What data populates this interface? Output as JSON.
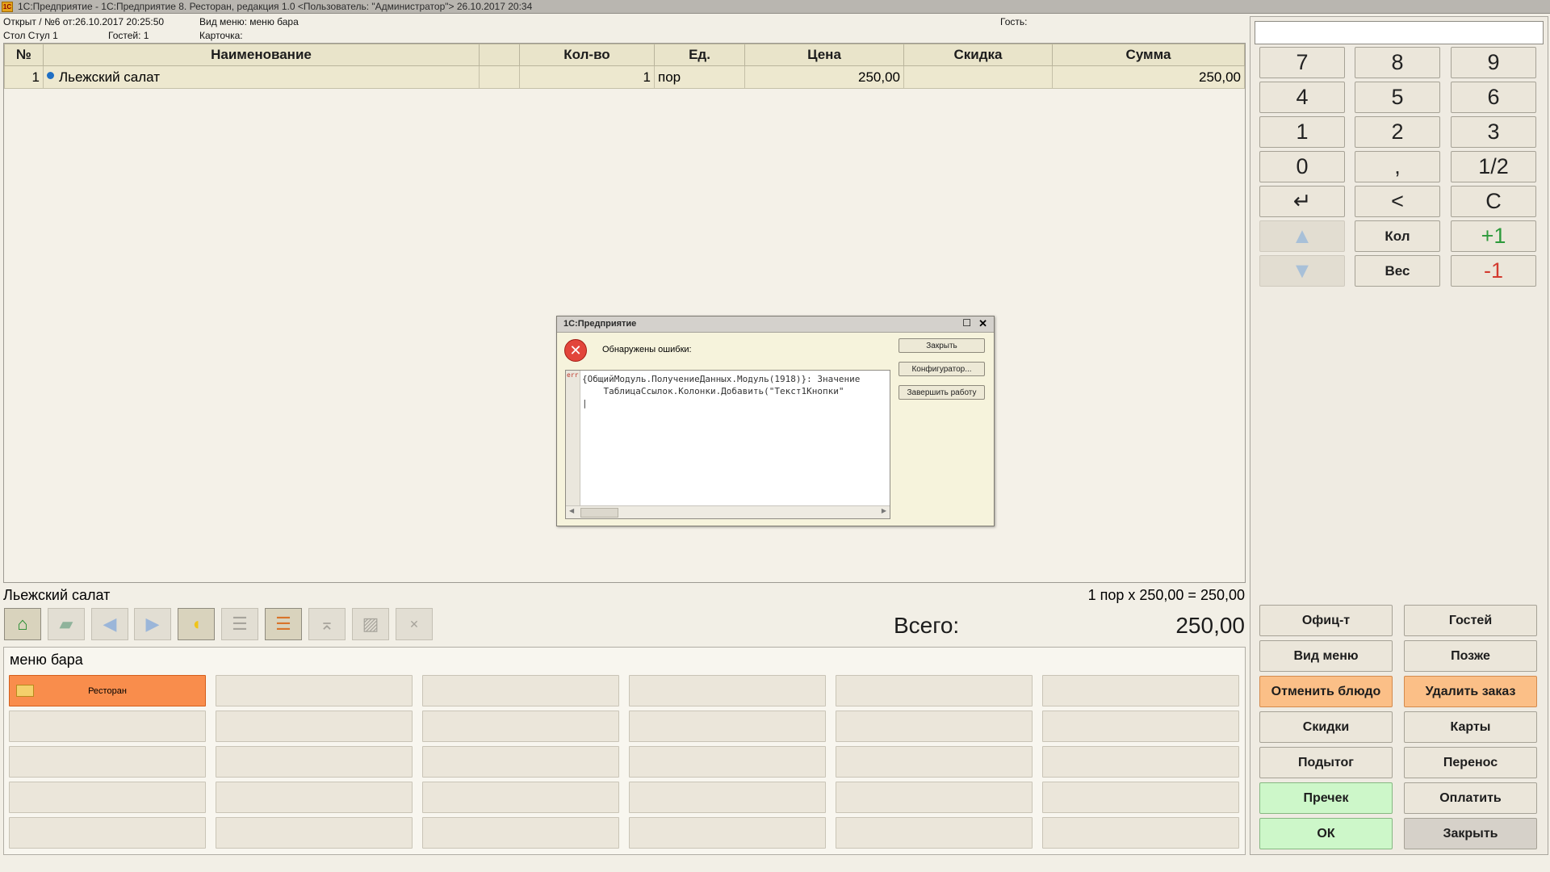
{
  "window": {
    "title": "1С:Предприятие - 1С:Предприятие 8. Ресторан, редакция 1.0 <Пользователь: \"Администратор\"> 26.10.2017 20:34",
    "logo": "1C"
  },
  "header": {
    "status": "Открыт / №6 от:26.10.2017 20:25:50",
    "menu_type": "Вид меню: меню бара",
    "guest_label": "Гость:",
    "table": "Стол Стул 1",
    "guests": "Гостей:  1",
    "card": "Карточка:"
  },
  "order": {
    "columns": [
      "№",
      "Наименование",
      "",
      "Кол-во",
      "Ед.",
      "Цена",
      "Скидка",
      "Сумма"
    ],
    "rows": [
      {
        "num": "1",
        "name": "Льежский салат",
        "qty": "1",
        "unit": "пор",
        "price": "250,00",
        "discount": "",
        "sum": "250,00"
      }
    ]
  },
  "summary": {
    "selected_item": "Льежский салат",
    "calc": "1 пор x 250,00 = 250,00",
    "total_label": "Всего:",
    "total_value": "250,00"
  },
  "toolbar": {
    "icons": [
      "home-icon",
      "folder-up-icon",
      "arrow-left-icon",
      "arrow-right-icon",
      "lemon-icon",
      "sort-list-icon",
      "sort-active-icon",
      "pin-icon",
      "edit-icon",
      "close-icon"
    ]
  },
  "menu": {
    "title": "меню бара",
    "first_item": "Ресторан"
  },
  "keypad": {
    "keys": [
      "7",
      "8",
      "9",
      "4",
      "5",
      "6",
      "1",
      "2",
      "3",
      "0",
      ",",
      "1/2",
      "↵",
      "<",
      "C"
    ],
    "qty_label": "Кол",
    "plus_one": "+1",
    "weight_label": "Вес",
    "minus_one": "-1"
  },
  "actions": {
    "waiter": "Офиц-т",
    "guests": "Гостей",
    "menu_view": "Вид меню",
    "later": "Позже",
    "cancel_dish": "Отменить блюдо",
    "delete_order": "Удалить заказ",
    "discounts": "Скидки",
    "cards": "Карты",
    "subtotal": "Подытог",
    "transfer": "Перенос",
    "precheck": "Пречек",
    "pay": "Оплатить",
    "ok": "ОК",
    "close": "Закрыть"
  },
  "dialog": {
    "title": "1С:Предприятие",
    "message": "Обнаружены ошибки:",
    "btn_close": "Закрыть",
    "btn_configurator": "Конфигуратор...",
    "btn_exit": "Завершить работу",
    "err_tag": "err",
    "line1": "{ОбщийМодуль.ПолучениеДанных.Модуль(1918)}: Значение",
    "line2": "    ТаблицаСсылок.Колонки.Добавить(\"Текст1Кнопки\""
  },
  "colors": {
    "accent_orange": "#f98d4c",
    "green_button": "#cdf7c9",
    "panel_bg": "#f2efe6"
  }
}
